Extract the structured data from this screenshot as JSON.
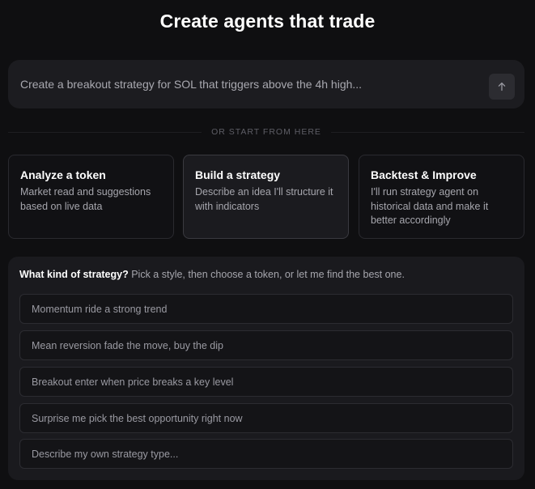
{
  "header": {
    "title": "Create agents that trade"
  },
  "prompt": {
    "placeholder": "Create a breakout strategy for SOL that triggers above the 4h high..."
  },
  "divider": {
    "label": "OR START FROM HERE"
  },
  "cards": [
    {
      "title": "Analyze a token",
      "description": "Market read and suggestions based on live data"
    },
    {
      "title": "Build a strategy",
      "description": "Describe an idea I'll structure it with indicators"
    },
    {
      "title": "Backtest & Improve",
      "description": "I'll run strategy agent on historical data and make it better accordingly"
    }
  ],
  "strategy": {
    "heading_bold": "What kind of strategy?",
    "heading_rest": "Pick a style, then choose a token, or let me find the best one.",
    "options": [
      "Momentum ride a strong trend",
      "Mean reversion fade the move, buy the dip",
      "Breakout enter when price breaks a key level",
      "Surprise me pick the best opportunity right now"
    ],
    "custom_placeholder": "Describe my own strategy type..."
  },
  "icons": {
    "send": "arrow-up-icon"
  },
  "colors": {
    "background": "#0f0f11",
    "panel": "#1a1a1e",
    "text_primary": "#ffffff",
    "text_secondary": "#a6a6ad"
  }
}
